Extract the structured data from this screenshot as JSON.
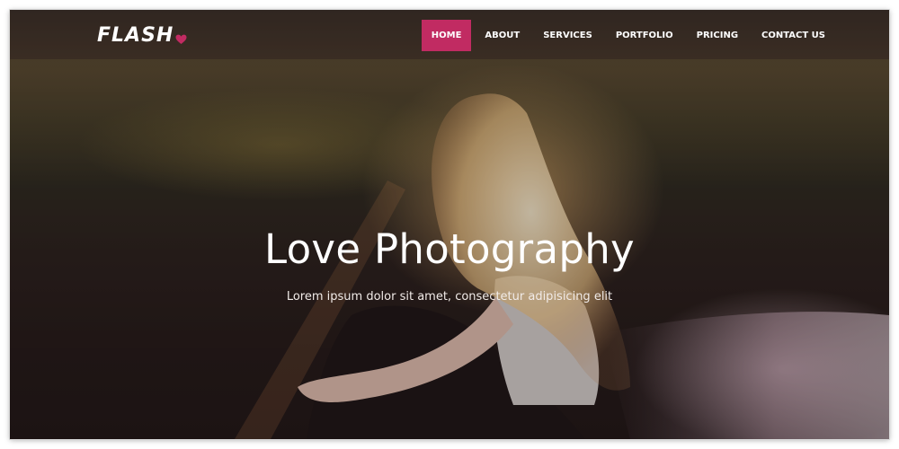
{
  "brand": {
    "logo_text": "FLASH",
    "heart_icon": "heart-icon",
    "accent_color": "#c12b62"
  },
  "nav": {
    "items": [
      {
        "label": "HOME",
        "active": true
      },
      {
        "label": "ABOUT",
        "active": false
      },
      {
        "label": "SERVICES",
        "active": false
      },
      {
        "label": "PORTFOLIO",
        "active": false
      },
      {
        "label": "PRICING",
        "active": false
      },
      {
        "label": "CONTACT US",
        "active": false
      }
    ]
  },
  "hero": {
    "title": "Love Photography",
    "subtitle": "Lorem ipsum dolor sit amet, consectetur adipisicing elit"
  }
}
